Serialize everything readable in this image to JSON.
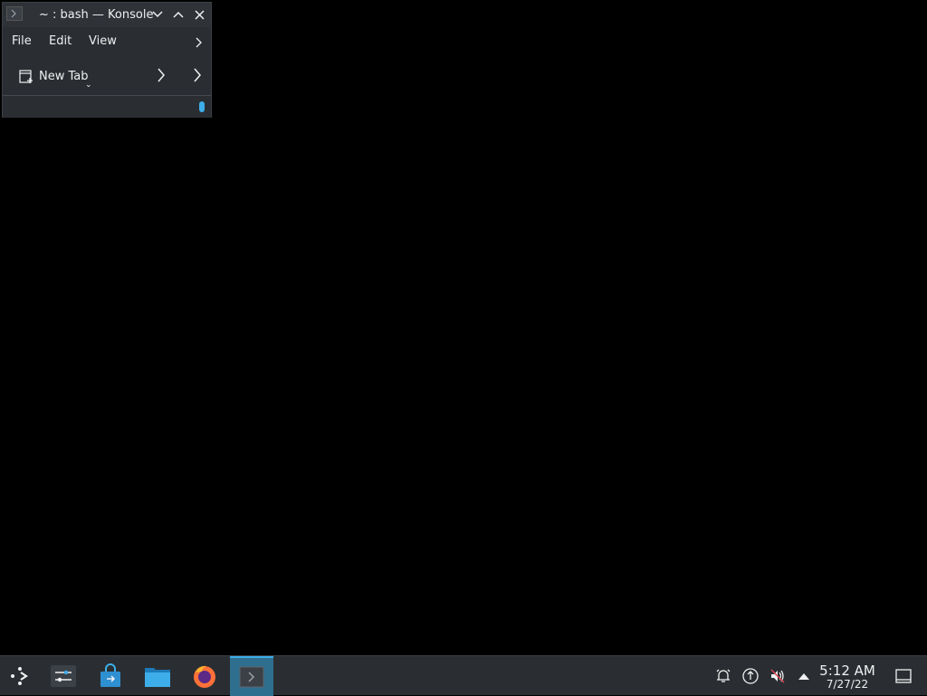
{
  "window": {
    "title": "~ : bash — Konsole",
    "menu": [
      "File",
      "Edit",
      "View"
    ],
    "toolbar": {
      "new_tab_label": "New Tab"
    },
    "icons": {
      "app": "konsole-icon",
      "minimize": "chevron-down-icon",
      "maximize": "chevron-up-icon",
      "close": "close-icon",
      "menu_more": "chevron-right-icon",
      "new_tab": "new-tab-icon"
    }
  },
  "taskbar": {
    "launchers": [
      {
        "name": "application-launcher",
        "icon": "steamdeck-launcher-icon"
      },
      {
        "name": "system-settings",
        "icon": "settings-sliders-icon"
      },
      {
        "name": "discover",
        "icon": "store-bag-icon"
      },
      {
        "name": "dolphin",
        "icon": "folder-icon"
      },
      {
        "name": "firefox",
        "icon": "firefox-icon"
      },
      {
        "name": "konsole",
        "icon": "terminal-icon",
        "active": true
      }
    ],
    "tray": [
      "notifications-icon",
      "network-icon",
      "volume-muted-icon",
      "expand-tray-icon"
    ],
    "clock": {
      "time": "5:12 AM",
      "date": "7/27/22"
    },
    "show_desktop_icon": "show-desktop-icon"
  },
  "colors": {
    "accent": "#3daee9",
    "panel": "#2a2e32",
    "text": "#eff0f1"
  }
}
